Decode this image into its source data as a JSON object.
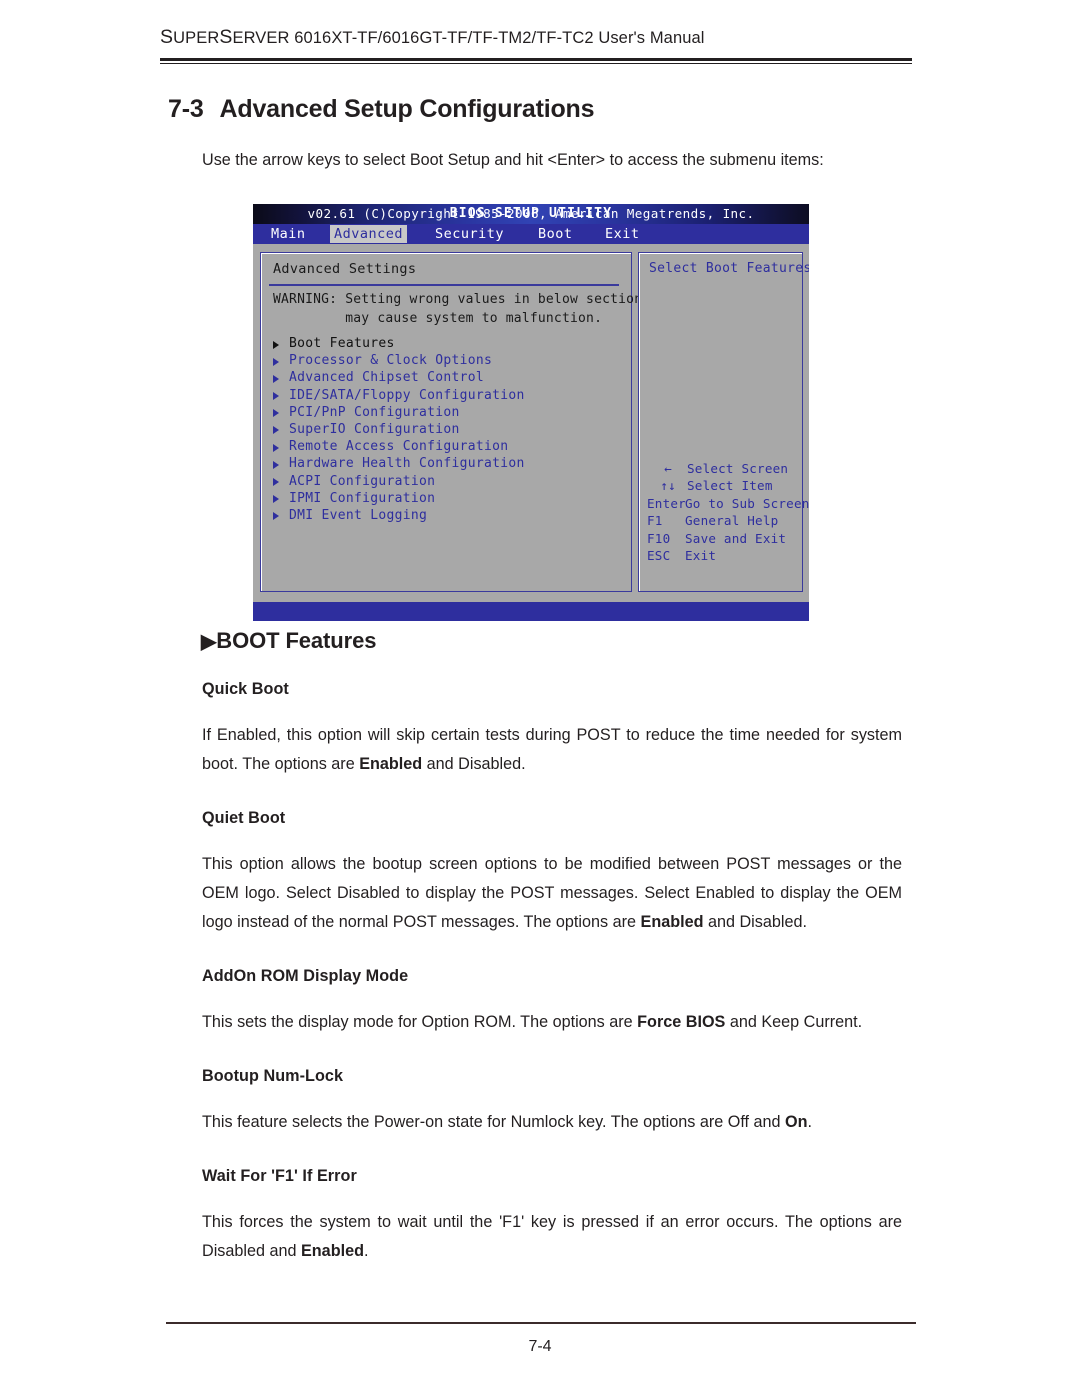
{
  "header": {
    "title_lead": "S",
    "title": "SUPERSERVER 6016XT-TF/6016GT-TF/TF-TM2/TF-TC2 User's Manual",
    "title_part1": "S",
    "title_part2": "UPER",
    "title_part3": "S",
    "title_part4": "ERVER",
    "title_part5": " 6016XT-TF/6016GT-TF/TF-TM2/TF-TC2 User's Manual"
  },
  "section": {
    "number": "7-3",
    "title": "Advanced Setup Configurations",
    "intro": "Use the arrow keys to select Boot Setup and hit <Enter> to access the submenu items:"
  },
  "bios": {
    "title": "BIOS SETUP UTILITY",
    "tabs": [
      {
        "label": "Main",
        "active": false
      },
      {
        "label": "Advanced",
        "active": true
      },
      {
        "label": "Security",
        "active": false
      },
      {
        "label": "Boot",
        "active": false
      },
      {
        "label": "Exit",
        "active": false
      }
    ],
    "panel_title": "Advanced Settings",
    "warning_line1": "WARNING: Setting wrong values in below sections",
    "warning_line2": "         may cause system to malfunction.",
    "menu_items": [
      {
        "label": "Boot Features",
        "selected": true
      },
      {
        "label": "Processor & Clock Options",
        "selected": false
      },
      {
        "label": "Advanced Chipset Control",
        "selected": false
      },
      {
        "label": "IDE/SATA/Floppy Configuration",
        "selected": false
      },
      {
        "label": "PCI/PnP Configuration",
        "selected": false
      },
      {
        "label": "SuperIO Configuration",
        "selected": false
      },
      {
        "label": "Remote Access Configuration",
        "selected": false
      },
      {
        "label": "Hardware Health Configuration",
        "selected": false
      },
      {
        "label": "ACPI Configuration",
        "selected": false
      },
      {
        "label": "IPMI Configuration",
        "selected": false
      },
      {
        "label": "DMI Event Logging",
        "selected": false
      }
    ],
    "help_title": "Select Boot Features",
    "legend": [
      {
        "key": "←",
        "desc": "Select Screen",
        "center": true
      },
      {
        "key": "↑↓",
        "desc": "Select Item",
        "center": true
      },
      {
        "key": "Enter",
        "desc": "Go to Sub Screen",
        "center": false
      },
      {
        "key": "F1",
        "desc": "General Help",
        "center": false
      },
      {
        "key": "F10",
        "desc": "Save and Exit",
        "center": false
      },
      {
        "key": "ESC",
        "desc": "Exit",
        "center": false
      }
    ],
    "footer": "v02.61 (C)Copyright 1985-2006, American Megatrends, Inc."
  },
  "boot_features": {
    "heading_caret": "▶",
    "heading": "BOOT Features",
    "items": [
      {
        "title": "Quick Boot",
        "body_pre": "If Enabled, this option will skip certain tests during POST  to reduce the time needed for system boot. The options are ",
        "body_bold": "Enabled",
        "body_post": " and Disabled."
      },
      {
        "title": "Quiet Boot",
        "body_pre": "This option allows the bootup screen options to be modified between POST messages or the OEM logo. Select Disabled to display the POST messages. Select Enabled to display the OEM logo instead of the normal POST messages. The options are ",
        "body_bold": "Enabled",
        "body_post": " and Disabled."
      },
      {
        "title": "AddOn ROM Display Mode",
        "body_pre": "This sets the display mode for Option ROM. The options are ",
        "body_bold": "Force BIOS",
        "body_post": " and Keep Current."
      },
      {
        "title": "Bootup Num-Lock",
        "body_pre": "This feature selects the Power-on state for Numlock key. The options are Off and ",
        "body_bold": "On",
        "body_post": "."
      },
      {
        "title": "Wait For 'F1' If Error",
        "body_pre": "This forces the system to wait until the 'F1' key is pressed if an error occurs. The options are Disabled and ",
        "body_bold": "Enabled",
        "body_post": "."
      }
    ]
  },
  "footer": {
    "page_number": "7-4"
  }
}
